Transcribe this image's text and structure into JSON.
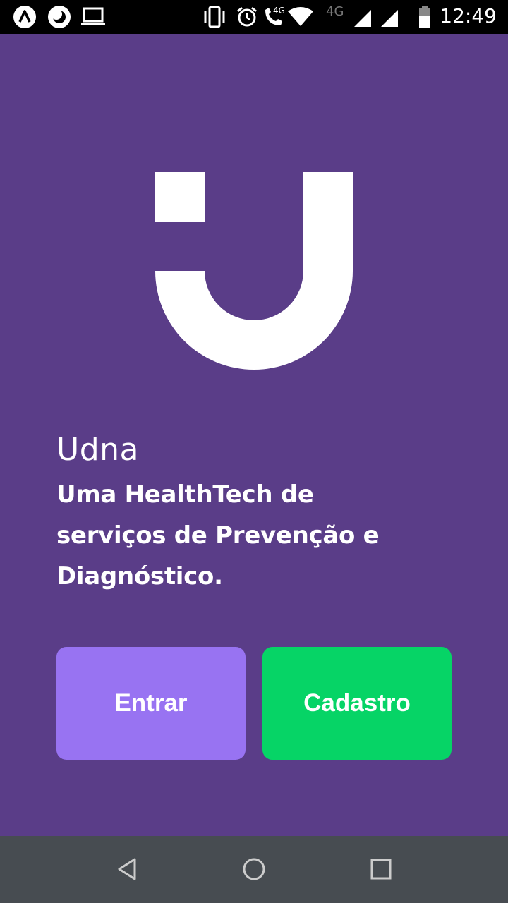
{
  "status_bar": {
    "time": "12:49",
    "network_label": "4G",
    "data_label": "4G",
    "icons": [
      "app-logo-icon",
      "do-not-disturb-icon",
      "laptop-icon",
      "vibrate-icon",
      "alarm-icon",
      "volte-call-icon",
      "wifi-icon",
      "signal-icon",
      "signal-icon-2",
      "battery-icon"
    ]
  },
  "brand": {
    "name": "Udna",
    "tagline_lines": [
      "Uma HealthTech de",
      "serviços de Prevenção e",
      "Diagnóstico."
    ]
  },
  "buttons": {
    "login": "Entrar",
    "signup": "Cadastro"
  },
  "colors": {
    "background": "#5a3d88",
    "login_button": "#9873f2",
    "signup_button": "#06d466",
    "nav_bar": "#474c51"
  },
  "nav_bar": {
    "icons": [
      "back-icon",
      "home-icon",
      "recents-icon"
    ]
  }
}
